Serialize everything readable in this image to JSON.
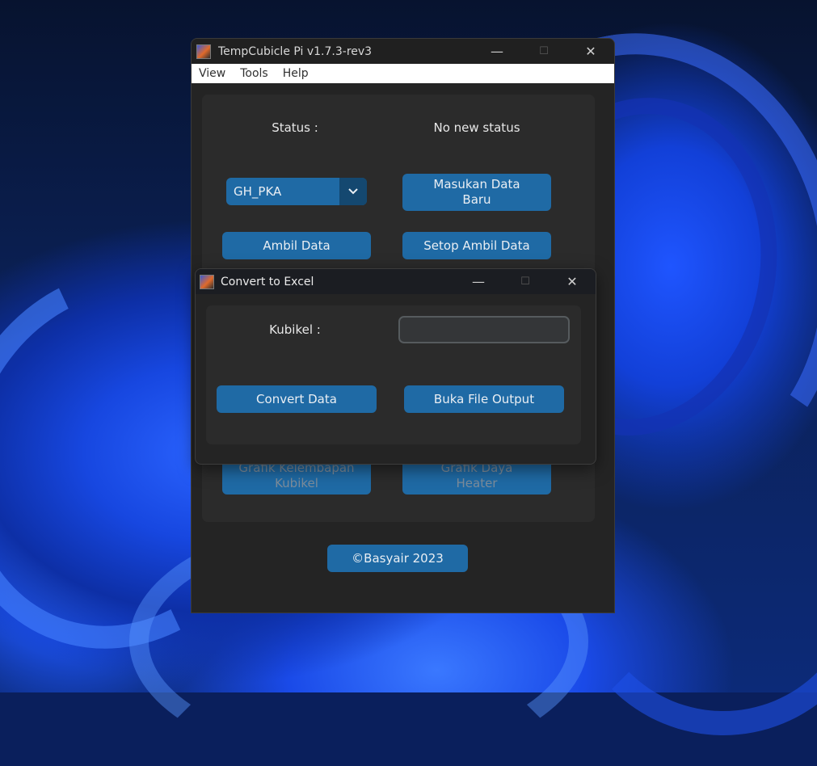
{
  "main_window": {
    "title": "TempCubicle Pi v1.7.3-rev3",
    "menu": [
      "View",
      "Tools",
      "Help"
    ],
    "status_label": "Status :",
    "status_value": "No new status",
    "combo_value": "GH_PKA",
    "combo_arrow_icon": "chevron-down-icon",
    "btn_masukan": "Masukan Data\nBaru",
    "btn_ambil": "Ambil Data",
    "btn_setop": "Setop Ambil Data",
    "btn_grafik_kelembapan": "Grafik Kelembapan\nKubikel",
    "btn_grafik_daya": "Grafik Daya\nHeater",
    "footer_button": "©Basyair 2023"
  },
  "dialog": {
    "title": "Convert to Excel",
    "kubikel_label": "Kubikel :",
    "kubikel_value": "",
    "btn_convert": "Convert Data",
    "btn_buka": "Buka File Output"
  },
  "caption_icons": {
    "minimize": "—",
    "maximize": "☐",
    "close": "✕"
  },
  "colors": {
    "accent": "#1f6aa5",
    "window_bg": "#242424",
    "panel_bg": "#2b2b2b"
  }
}
